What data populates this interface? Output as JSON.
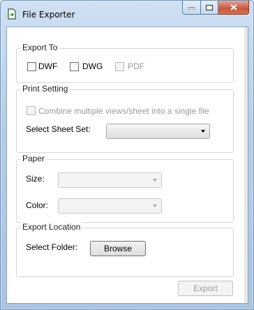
{
  "window": {
    "title": "File Exporter",
    "buttons": {
      "minimize": "minimize",
      "maximize": "maximize",
      "close": "close"
    }
  },
  "export_to": {
    "title": "Export To",
    "options": [
      {
        "label": "DWF",
        "checked": false,
        "enabled": true
      },
      {
        "label": "DWG",
        "checked": false,
        "enabled": true
      },
      {
        "label": "PDF",
        "checked": false,
        "enabled": false
      }
    ]
  },
  "print_setting": {
    "title": "Print Setting",
    "combine_label": "Combine multiple views/sheet into a single file",
    "sheet_set_label": "Select Sheet Set:",
    "sheet_set_value": ""
  },
  "paper": {
    "title": "Paper",
    "size_label": "Size:",
    "size_value": "",
    "color_label": "Color:",
    "color_value": ""
  },
  "export_location": {
    "title": "Export Location",
    "folder_label": "Select Folder:",
    "browse_label": "Browse"
  },
  "footer": {
    "export_label": "Export"
  },
  "icons": {
    "app": "document-export-icon",
    "minimize": "minimize-icon",
    "maximize": "maximize-icon",
    "close": "close-icon",
    "dropdown": "chevron-down-icon"
  }
}
